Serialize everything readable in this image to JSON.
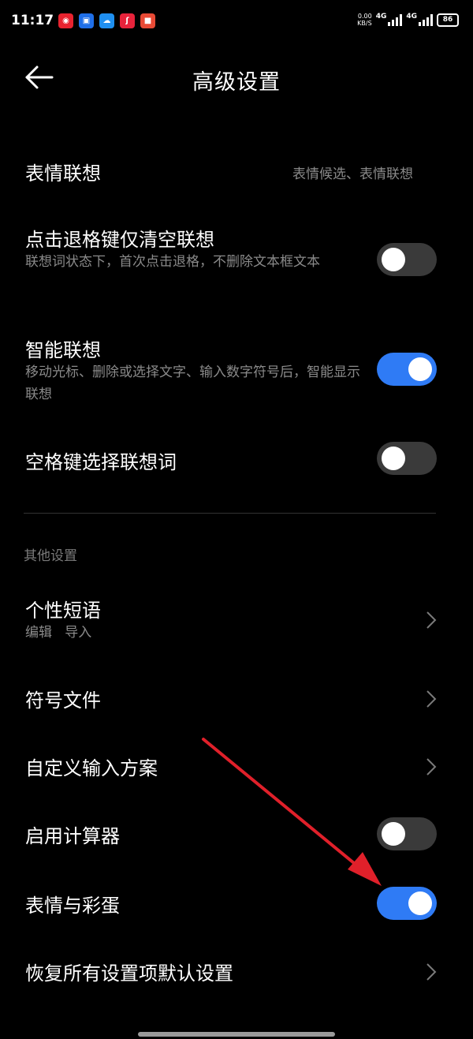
{
  "status_bar": {
    "time": "11:17",
    "speed_top": "0.00",
    "speed_bottom": "KB/S",
    "net1": "4G",
    "net2": "4G",
    "battery": "86",
    "notif_colors": [
      "#e8232f",
      "#1f6fe8",
      "#1f8ff0",
      "#e8233b",
      "#e84a35"
    ]
  },
  "header": {
    "title": "高级设置",
    "back_icon": "arrow-left-icon"
  },
  "settings": {
    "emoji_assoc": {
      "title": "表情联想",
      "value": "表情候选、表情联想"
    },
    "backspace_clear": {
      "title": "点击退格键仅清空联想",
      "subtitle": "联想词状态下，首次点击退格，不删除文本框文本",
      "enabled": false
    },
    "smart_assoc": {
      "title": "智能联想",
      "subtitle": "移动光标、删除或选择文字、输入数字符号后，智能显示联想",
      "enabled": true
    },
    "space_select": {
      "title": "空格键选择联想词",
      "enabled": false
    }
  },
  "other_section": {
    "label": "其他设置",
    "personal_phrases": {
      "title": "个性短语",
      "subtitle": "编辑   导入"
    },
    "symbol_files": {
      "title": "符号文件"
    },
    "custom_input": {
      "title": "自定义输入方案"
    },
    "calculator": {
      "title": "启用计算器",
      "enabled": false
    },
    "emoji_easter": {
      "title": "表情与彩蛋",
      "enabled": true
    },
    "restore_defaults": {
      "title": "恢复所有设置项默认设置"
    }
  },
  "colors": {
    "background": "#000000",
    "toggle_on": "#2f7bf5",
    "toggle_off": "#3a3a3a",
    "secondary_text": "#8a8a8a",
    "annotation_arrow": "#e0202a"
  }
}
